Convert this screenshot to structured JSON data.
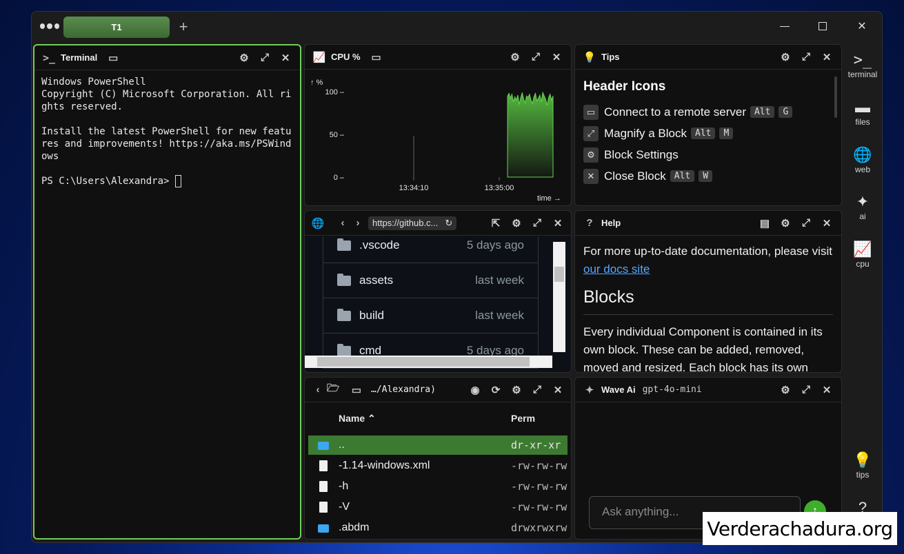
{
  "window": {
    "tab_label": "T1",
    "add_tab": "+"
  },
  "terminal": {
    "title": "Terminal",
    "lines": "Windows PowerShell\nCopyright (C) Microsoft Corporation. All rights reserved.\n\nInstall the latest PowerShell for new features and improvements! https://aka.ms/PSWindows\n\nPS C:\\Users\\Alexandra> "
  },
  "cpu": {
    "title": "CPU %",
    "y_unit": "↑ %",
    "x_unit": "time →",
    "y_ticks": [
      "100 –",
      "50 –",
      "0 –"
    ],
    "x_ticks": [
      "13:34:10",
      "13:35:00"
    ],
    "accent": "#58c142"
  },
  "chart_data": {
    "type": "area",
    "title": "CPU %",
    "xlabel": "time →",
    "ylabel": "↑ %",
    "ylim": [
      0,
      100
    ],
    "x_tick_labels": [
      "13:34:10",
      "13:35:00"
    ],
    "series": [
      {
        "values": [
          0,
          0,
          0,
          0,
          0,
          0,
          0,
          0,
          0,
          0,
          0,
          0,
          0,
          0,
          0,
          0,
          0,
          0,
          0,
          0,
          0,
          0,
          0,
          0,
          0,
          0,
          0,
          0,
          0,
          0,
          0,
          0,
          0,
          0,
          0,
          0,
          0,
          0,
          0,
          0,
          0,
          0,
          0,
          0,
          0,
          0,
          0,
          0,
          0,
          0,
          0,
          0,
          0,
          0,
          0,
          0,
          0,
          0,
          0,
          0,
          0,
          0,
          0,
          0,
          0,
          0,
          0,
          0,
          0,
          0,
          0,
          0,
          0,
          0,
          0,
          0,
          0,
          0,
          0,
          0,
          0,
          0,
          0,
          0,
          0,
          0,
          0,
          0,
          0,
          0,
          0,
          0,
          0,
          0,
          0,
          0,
          0,
          0,
          0,
          0,
          0,
          0,
          0,
          0,
          0,
          0,
          0,
          0,
          0,
          0,
          95,
          98,
          92,
          97,
          88,
          94,
          90,
          96,
          85,
          93,
          99,
          91,
          87,
          95,
          93,
          97,
          90,
          86,
          94,
          98,
          89,
          92,
          96,
          88,
          99,
          95,
          91,
          84,
          93,
          97,
          90,
          95
        ]
      }
    ]
  },
  "tips": {
    "title": "Tips",
    "heading": "Header Icons",
    "rows": [
      {
        "label": "Connect to a remote server",
        "keys": [
          "Alt",
          "G"
        ]
      },
      {
        "label": "Magnify a Block",
        "keys": [
          "Alt",
          "M"
        ]
      },
      {
        "label": "Block Settings",
        "keys": []
      },
      {
        "label": "Close Block",
        "keys": [
          "Alt",
          "W"
        ]
      }
    ]
  },
  "web": {
    "url": "https://github.c...",
    "rows": [
      {
        "name": ".vscode",
        "when": "5 days ago"
      },
      {
        "name": "assets",
        "when": "last week"
      },
      {
        "name": "build",
        "when": "last week"
      },
      {
        "name": "cmd",
        "when": "5 days ago"
      }
    ]
  },
  "help": {
    "title": "Help",
    "intro": "For more up-to-date documentation, please visit ",
    "link": "our docs site",
    "heading": "Blocks",
    "para": "Every individual Component is contained in its own block. These can be added, removed, moved and resized. Each block has its own"
  },
  "files": {
    "path": "…/Alexandra)",
    "col_name": "Name ⌃",
    "col_perm": "Perm",
    "rows": [
      {
        "name": "..",
        "perm": "dr-xr-xr",
        "kind": "dir"
      },
      {
        "name": "-1.14-windows.xml",
        "perm": "-rw-rw-rw",
        "kind": "file"
      },
      {
        "name": "-h",
        "perm": "-rw-rw-rw",
        "kind": "file"
      },
      {
        "name": "-V",
        "perm": "-rw-rw-rw",
        "kind": "file"
      },
      {
        "name": ".abdm",
        "perm": "drwxrwxrw",
        "kind": "dir"
      }
    ]
  },
  "ai": {
    "title": "Wave Ai",
    "model": "gpt-4o-mini",
    "placeholder": "Ask anything..."
  },
  "sidebar": {
    "items": [
      {
        "label": "terminal",
        "icon": "terminal-icon"
      },
      {
        "label": "files",
        "icon": "folder-icon"
      },
      {
        "label": "web",
        "icon": "globe-icon"
      },
      {
        "label": "ai",
        "icon": "sparkles-icon"
      },
      {
        "label": "cpu",
        "icon": "chart-icon"
      }
    ],
    "bottom": [
      {
        "label": "tips",
        "icon": "lightbulb-icon"
      },
      {
        "label": "",
        "icon": "help-icon"
      }
    ]
  },
  "watermark": "Verderachadura.org"
}
